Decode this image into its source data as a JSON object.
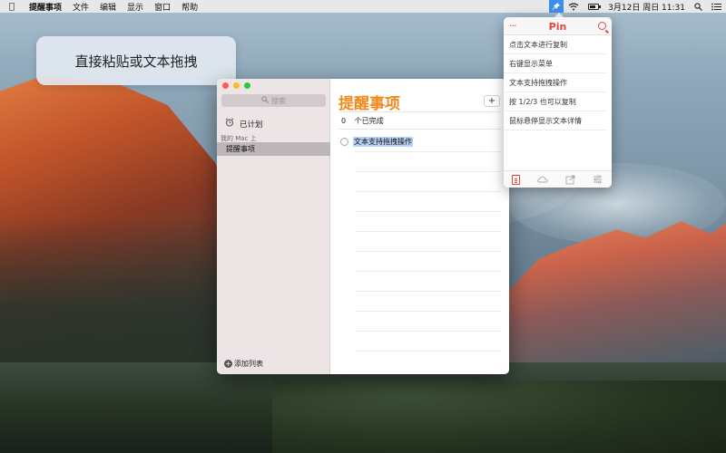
{
  "menubar": {
    "apple_icon": "apple-icon",
    "app_name": "提醒事项",
    "menus": [
      "文件",
      "编辑",
      "显示",
      "窗口",
      "帮助"
    ],
    "status": {
      "pin_icon": "pin-icon",
      "wifi_icon": "wifi-icon",
      "battery_level": 0.6,
      "clock": "3月12日 周日 11:31",
      "search_icon": "spotlight-icon",
      "list_icon": "notification-center-icon"
    }
  },
  "caption": {
    "text": "直接粘贴或文本拖拽"
  },
  "reminders": {
    "search_placeholder": "搜索",
    "sidebar": {
      "scheduled": "已计划",
      "group_label": "我的 Mac 上",
      "active_list": "提醒事项",
      "add_list": "添加列表"
    },
    "main": {
      "title": "提醒事项",
      "add_button": "+",
      "completed_count": "0",
      "completed_label": "个已完成",
      "items": [
        "文本支持拖拽操作"
      ]
    }
  },
  "pin": {
    "title": "Pin",
    "more_icon": "···",
    "rows": [
      "点击文本进行复制",
      "右键显示菜单",
      "文本支持拖拽操作",
      "按 1/2/3 也可以复制",
      "鼠标悬停显示文本详情"
    ],
    "accent_color": "#e2453c"
  }
}
